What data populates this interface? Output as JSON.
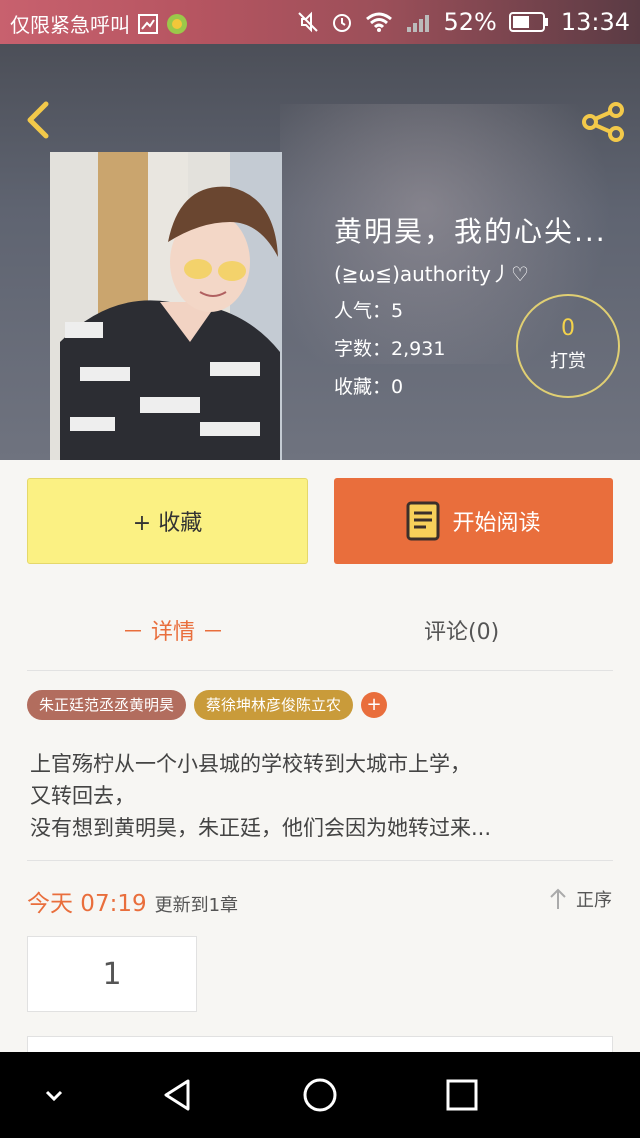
{
  "status_bar": {
    "carrier": "仅限紧急呼叫",
    "battery": "52%",
    "time": "13:34"
  },
  "book": {
    "title": "黄明昊，我的心尖...",
    "author": "(≧ω≦)authority丿♡",
    "popularity_label": "人气：",
    "popularity": "5",
    "wordcount_label": "字数：",
    "wordcount": "2,931",
    "favorites_label": "收藏：",
    "favorites": "0",
    "tip_count": "0",
    "tip_label": "打赏"
  },
  "actions": {
    "favorite": "+ 收藏",
    "read": "开始阅读"
  },
  "tabs": {
    "detail": "－ 详情 －",
    "comments": "评论(0)"
  },
  "tags": [
    "朱正廷范丞丞黄明昊",
    "蔡徐坤林彦俊陈立农"
  ],
  "tag_add": "+",
  "synopsis": [
    "上官殇柠从一个小县城的学校转到大城市上学，",
    "又转回去，",
    "没有想到黄明昊，朱正廷，他们会因为她转过来..."
  ],
  "update": {
    "date": "今天 07:19",
    "text": "更新到1章",
    "order": "正序"
  },
  "chapters": [
    "1"
  ],
  "colors": {
    "accent": "#e96e3c",
    "favorite_button": "#fbf183",
    "tip_number": "#f4d34b"
  },
  "icons": [
    "back-icon",
    "share-icon",
    "book-icon",
    "arrow-up-icon",
    "nav-down-icon",
    "nav-back-icon",
    "nav-home-icon",
    "nav-recent-icon"
  ]
}
